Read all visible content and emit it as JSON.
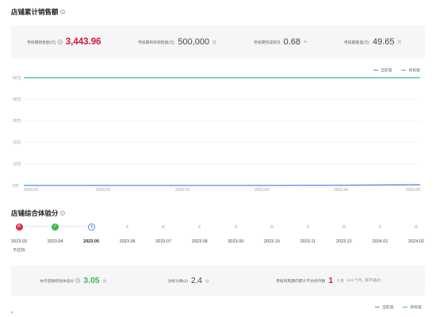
{
  "sales_section": {
    "title": "店铺累计销售额",
    "metrics": [
      {
        "label": "考核期销售额(元)",
        "value": "3,443.96",
        "unit": "",
        "has_help": true
      },
      {
        "label": "考核期目标销售额(元)",
        "value": "500,000",
        "unit": "元",
        "has_help": false
      },
      {
        "label": "考核期完成情况",
        "value": "0.68",
        "unit": "%",
        "has_help": false
      },
      {
        "label": "考核期差值(元)",
        "value": "49.65",
        "unit": "万",
        "has_help": false
      }
    ],
    "legend": [
      {
        "name": "当前值",
        "color": "#4a8ee8"
      },
      {
        "name": "目标值",
        "color": "#35b99a"
      }
    ]
  },
  "chart_data": {
    "type": "line",
    "x": [
      "2023.03",
      "2023.03",
      "2023.03",
      "2023.04",
      "2023.04",
      "2023.05"
    ],
    "y_ticks": [
      "0万",
      "10万",
      "20万",
      "30万",
      "40万",
      "50万"
    ],
    "ylim": [
      0,
      50
    ],
    "series": [
      {
        "name": "当前值",
        "color": "#4a8ee8",
        "values": [
          0,
          0,
          0,
          0,
          0.1,
          0.34
        ]
      },
      {
        "name": "目标值",
        "color": "#35b99a",
        "values": [
          50,
          50,
          50,
          50,
          50,
          50
        ]
      }
    ]
  },
  "score_section": {
    "title": "店铺综合体验分",
    "months": [
      {
        "label": "2023.03",
        "status": "fail",
        "status_text": "不达标"
      },
      {
        "label": "2023.04",
        "status": "pass",
        "status_text": ""
      },
      {
        "label": "2023.05",
        "status": "current",
        "status_text": ""
      },
      {
        "label": "2023.06",
        "status": "future",
        "status_text": ""
      },
      {
        "label": "2023.07",
        "status": "future",
        "status_text": ""
      },
      {
        "label": "2023.08",
        "status": "future",
        "status_text": ""
      },
      {
        "label": "2023.09",
        "status": "future",
        "status_text": ""
      },
      {
        "label": "2023.10",
        "status": "future",
        "status_text": ""
      },
      {
        "label": "2023.11",
        "status": "future",
        "status_text": ""
      },
      {
        "label": "2023.12",
        "status": "future",
        "status_text": ""
      },
      {
        "label": "2024.01",
        "status": "future",
        "status_text": ""
      },
      {
        "label": "2024.02",
        "status": "future",
        "status_text": ""
      }
    ],
    "card": {
      "current_label": "本月店铺综合体验分",
      "current_value": "3.05",
      "current_unit": "分",
      "target_label": "达标分数(≥)",
      "target_value": "2.4",
      "target_unit": "分",
      "fail_label": "考核目周期内累计不达标月数",
      "fail_value": "1",
      "fail_unit": "个月",
      "fail_note": "(≤ 8 个月，即不通过)"
    },
    "legend": [
      {
        "name": "当前值",
        "color": "#4a8ee8"
      },
      {
        "name": "目标值",
        "color": "#35b99a"
      }
    ],
    "bottom_tick": "4"
  }
}
